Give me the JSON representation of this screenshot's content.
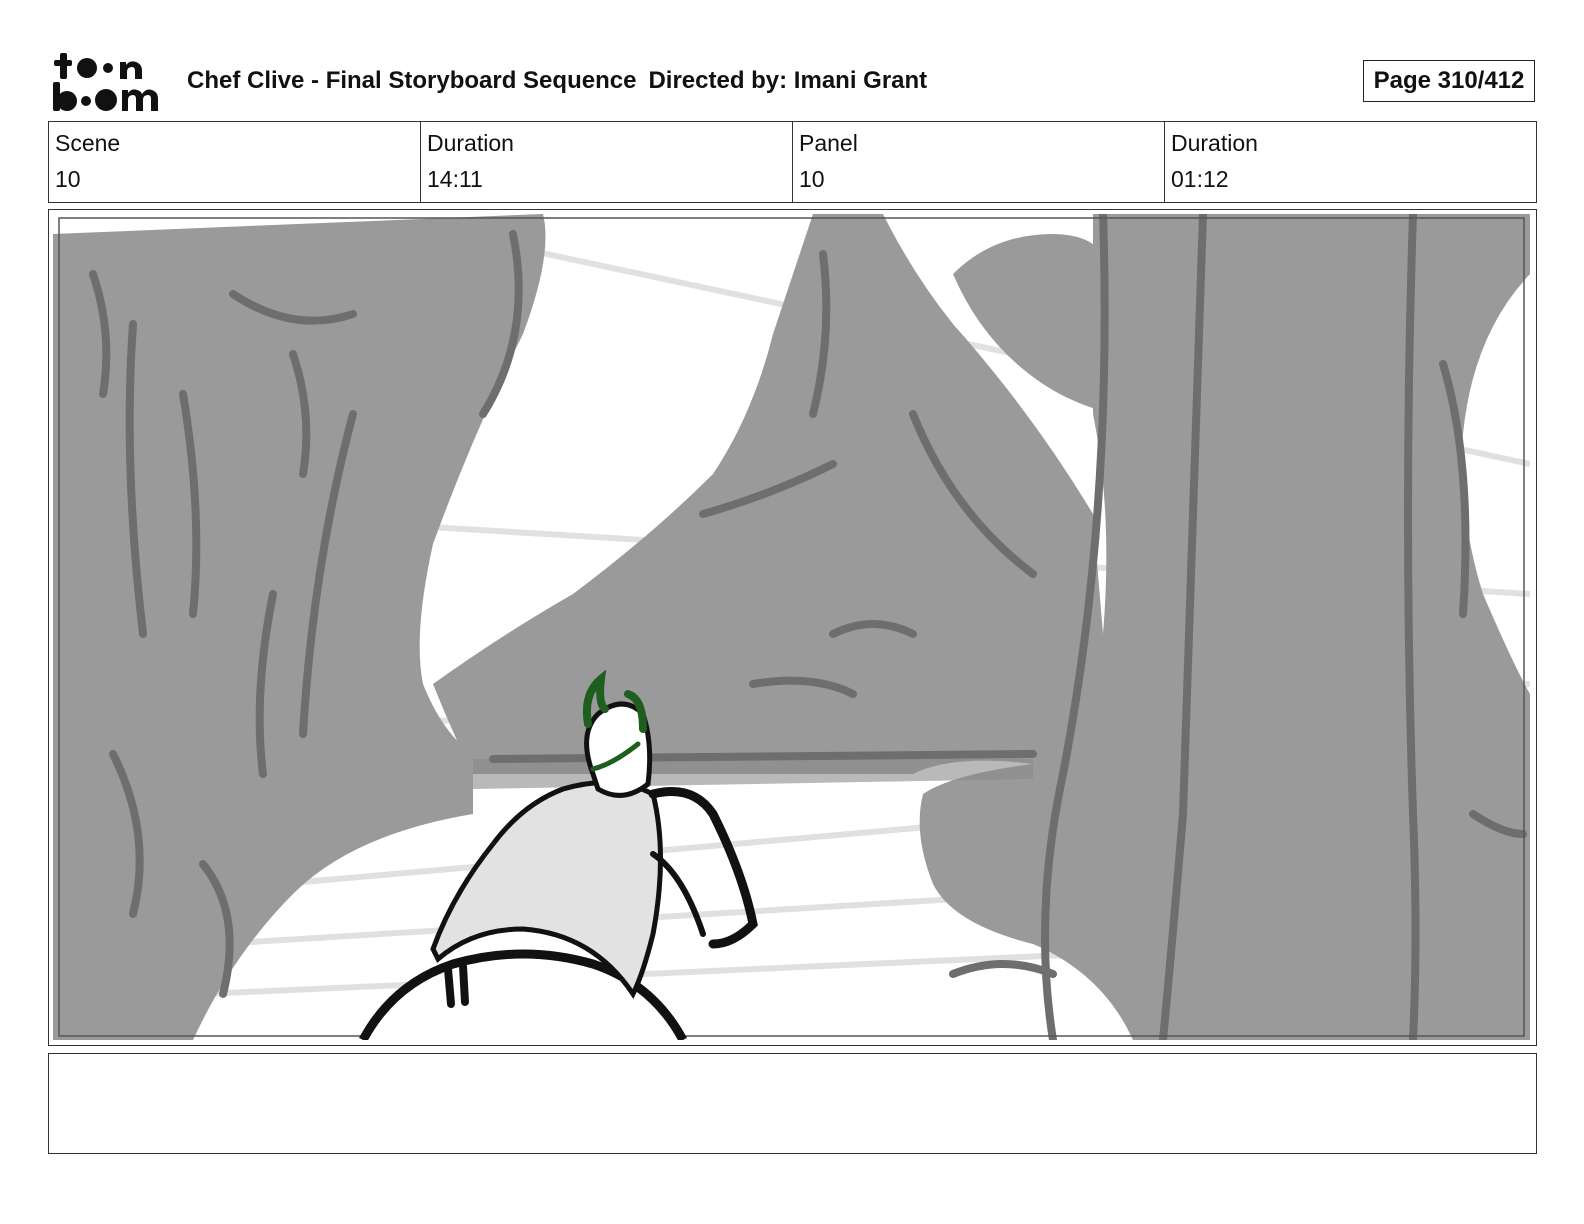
{
  "header": {
    "title": "Chef Clive - Final Storyboard Sequence",
    "director": "Directed by: Imani Grant",
    "page": "Page 310/412"
  },
  "logo": {
    "icon": "toon-boom-logo",
    "text": "toon boom"
  },
  "info": [
    {
      "label": "Scene",
      "value": "10"
    },
    {
      "label": "Duration",
      "value": "14:11"
    },
    {
      "label": "Panel",
      "value": "10"
    },
    {
      "label": "Duration",
      "value": "01:12"
    }
  ],
  "panel": {
    "icon": "storyboard-sketch-forest-character"
  },
  "notes": {
    "text": ""
  },
  "colors": {
    "sketch_gray": "#9a9a9a",
    "line_dark": "#6e6e6e",
    "ink": "#111111",
    "hair_green": "#1e5e1e",
    "body_light": "#e2e2e2"
  }
}
